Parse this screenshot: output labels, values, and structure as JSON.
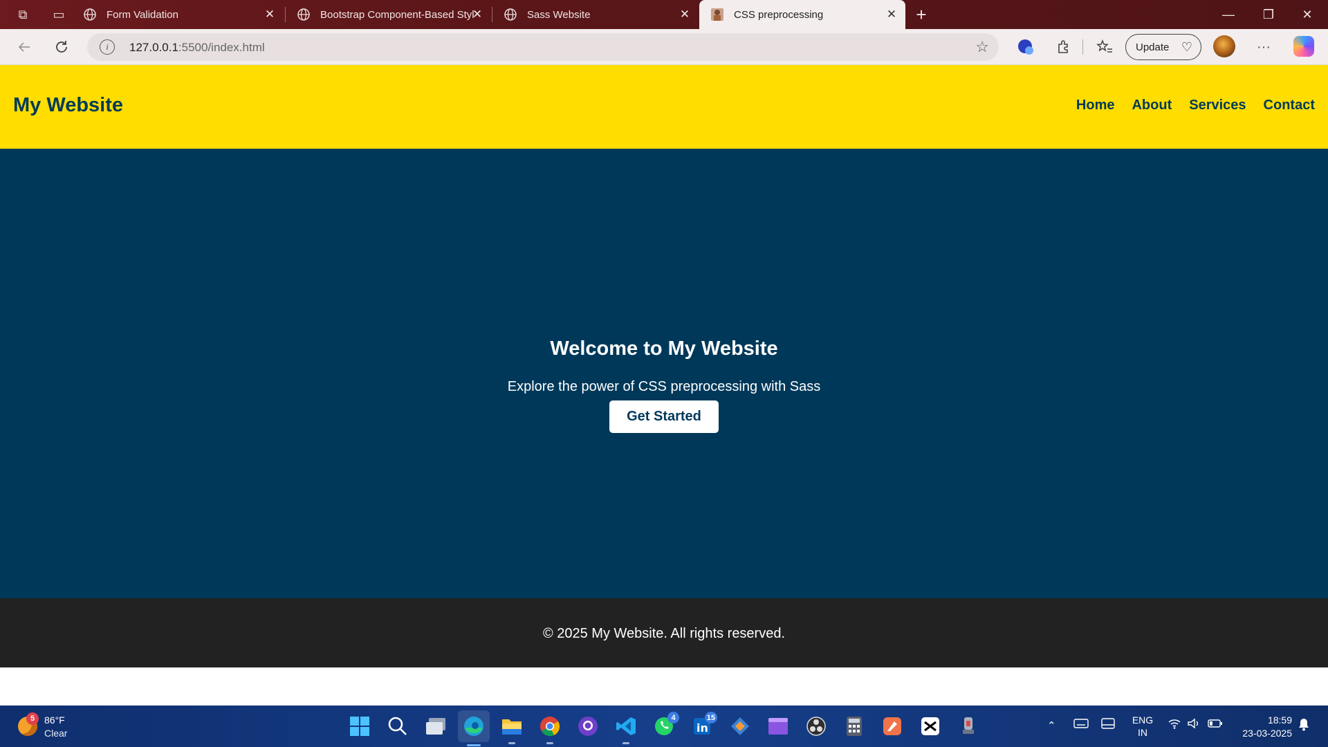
{
  "browser": {
    "tabs": [
      {
        "label": "Form Validation",
        "icon": "globe-icon"
      },
      {
        "label": "Bootstrap Component-Based Styl",
        "icon": "globe-icon"
      },
      {
        "label": "Sass Website",
        "icon": "globe-icon"
      },
      {
        "label": "CSS preprocessing",
        "icon": "page-favicon",
        "active": true
      }
    ],
    "url_host": "127.0.0.1",
    "url_rest": ":5500/index.html",
    "update_label": "Update"
  },
  "site": {
    "logo": "My Website",
    "nav": [
      "Home",
      "About",
      "Services",
      "Contact"
    ],
    "hero_title": "Welcome to My Website",
    "hero_subtitle": "Explore the power of CSS preprocessing with Sass",
    "cta_label": "Get Started",
    "footer_text": "© 2025 My Website. All rights reserved.",
    "colors": {
      "header": "#ffdd00",
      "hero": "#00385a",
      "footer": "#222222"
    }
  },
  "taskbar": {
    "weather_badge": "5",
    "weather_temp": "86°F",
    "weather_cond": "Clear",
    "whatsapp_badge": "4",
    "linkedin_badge": "15",
    "lang_top": "ENG",
    "lang_bottom": "IN",
    "time": "18:59",
    "date": "23-03-2025"
  }
}
